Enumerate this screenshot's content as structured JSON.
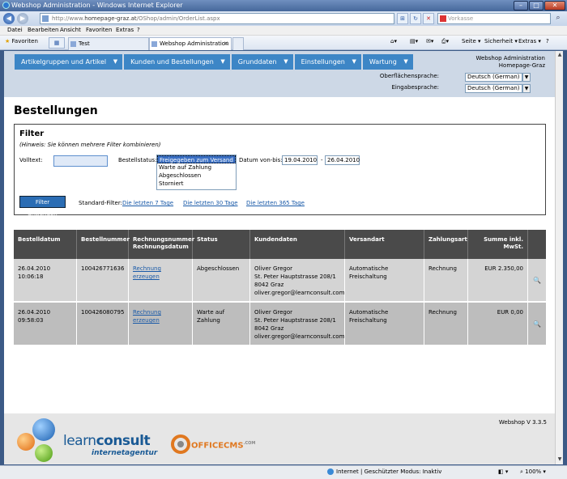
{
  "browser": {
    "title": "Webshop Administration - Windows Internet Explorer",
    "url_prefix": "http://www.",
    "url_domain": "homepage-graz.at",
    "url_path": "/OShop/admin/OrderList.aspx",
    "search_placeholder": "Vorkasse",
    "menu": [
      "Datei",
      "Bearbeiten",
      "Ansicht",
      "Favoriten",
      "Extras",
      "?"
    ],
    "favorites_label": "Favoriten",
    "tabs": [
      {
        "label": "Test"
      },
      {
        "label": "Webshop Administration"
      }
    ],
    "tools": {
      "page": "Seite ▾",
      "security": "Sicherheit ▾",
      "extras": "Extras ▾",
      "help": "?"
    },
    "status": {
      "zone": "Internet | Geschützter Modus: Inaktiv",
      "zoom": "100%"
    }
  },
  "header": {
    "nav": [
      "Artikelgruppen und Artikel",
      "Kunden und Bestellungen",
      "Grunddaten",
      "Einstellungen",
      "Wartung"
    ],
    "admin_title": "Webshop Administration",
    "admin_site": "Homepage-Graz",
    "ui_lang_label": "Oberflächensprache:",
    "ui_lang_value": "Deutsch (German)",
    "input_lang_label": "Eingabesprache:",
    "input_lang_value": "Deutsch (German)"
  },
  "page": {
    "title": "Bestellungen"
  },
  "filter": {
    "title": "Filter",
    "hint": "(Hinweis: Sie können mehrere Filter kombinieren)",
    "freetext_label": "Volltext:",
    "freetext_value": "",
    "status_label": "Bestellstatus:",
    "status_options": [
      "Freigegeben zum Versand",
      "Warte auf Zahlung",
      "Abgeschlossen",
      "Storniert"
    ],
    "status_selected_index": 0,
    "date_label": "Datum von-bis:",
    "date_from": "19.04.2010",
    "date_sep": "-",
    "date_to": "26.04.2010",
    "apply_label": "Filter anwenden",
    "standard_label": "Standard-Filter:",
    "presets": [
      "Die letzten 7 Tage",
      "Die letzten 30 Tage",
      "Die letzten 365 Tage"
    ]
  },
  "table": {
    "headers": [
      "Bestelldatum",
      "Bestellnummer",
      "Rechnungsnummer\nRechnungsdatum",
      "Status",
      "Kundendaten",
      "Versandart",
      "Zahlungsart",
      "Summe inkl.\nMwSt."
    ],
    "rows": [
      {
        "date": "26.04.2010\n10:06:18",
        "number": "100426771636",
        "invoice": "Rechnung erzeugen",
        "status": "Abgeschlossen",
        "customer": "Oliver Gregor\nSt. Peter Hauptstrasse 208/1\n8042 Graz\noliver.gregor@learnconsult.com",
        "shipping": "Automatische\nFreischaltung",
        "payment": "Rechnung",
        "sum": "EUR 2.350,00"
      },
      {
        "date": "26.04.2010\n09:58:03",
        "number": "100426080795",
        "invoice": "Rechnung erzeugen",
        "status": "Warte auf\nZahlung",
        "customer": "Oliver Gregor\nSt. Peter Hauptstrasse 208/1\n8042 Graz\noliver.gregor@learnconsult.com",
        "shipping": "Automatische\nFreischaltung",
        "payment": "Rechnung",
        "sum": "EUR 0,00"
      }
    ]
  },
  "footer": {
    "version": "Webshop V 3.3.5",
    "logo_learn": "learn",
    "logo_consult": "consult",
    "logo_sub": "internetagentur",
    "logo_office": "OFFICECMS",
    "logo_office_suffix": ".COM"
  },
  "colors": {
    "nav_blue": "#3d86c6",
    "header_bg": "#cdd8e6",
    "table_head": "#4a4a4a",
    "row_a": "#d4d4d4",
    "row_b": "#bdbdbd",
    "link": "#1a5aa8"
  }
}
